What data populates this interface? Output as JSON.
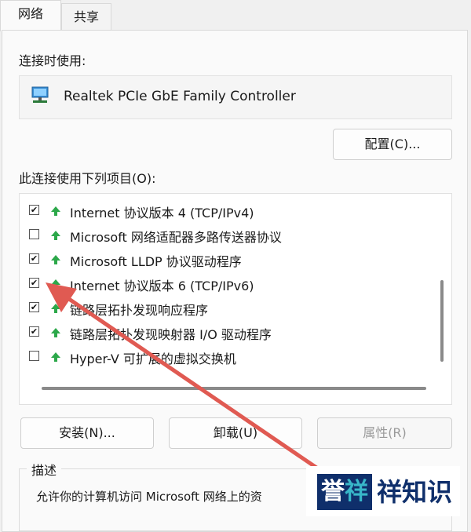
{
  "tabs": [
    {
      "label": "网络",
      "active": true
    },
    {
      "label": "共享",
      "active": false
    }
  ],
  "connect_using_label": "连接时使用:",
  "adapter": {
    "name": "Realtek PCIe GbE Family Controller",
    "icon": "network-adapter-icon"
  },
  "configure_button": "配置(C)...",
  "items_label": "此连接使用下列项目(O):",
  "items": [
    {
      "label": "Internet 协议版本 4 (TCP/IPv4)",
      "checked": true
    },
    {
      "label": "Microsoft 网络适配器多路传送器协议",
      "checked": false
    },
    {
      "label": "Microsoft LLDP 协议驱动程序",
      "checked": true
    },
    {
      "label": "Internet 协议版本 6 (TCP/IPv6)",
      "checked": true
    },
    {
      "label": "链路层拓扑发现响应程序",
      "checked": true
    },
    {
      "label": "链路层拓扑发现映射器 I/O 驱动程序",
      "checked": true
    },
    {
      "label": "Hyper-V 可扩展的虚拟交换机",
      "checked": false
    }
  ],
  "buttons": {
    "install": "安装(N)...",
    "uninstall": "卸载(U)",
    "properties": "属性(R)"
  },
  "description": {
    "title": "描述",
    "text": "允许你的计算机访问 Microsoft 网络上的资"
  },
  "watermark": {
    "badge_1": "誉",
    "badge_2": "祥",
    "text": "祥知识"
  },
  "colors": {
    "arrow": "#e05a52",
    "protocol_icon": "#2ca84a",
    "brand_navy": "#0f2f6b",
    "brand_cyan": "#38b7c9"
  }
}
